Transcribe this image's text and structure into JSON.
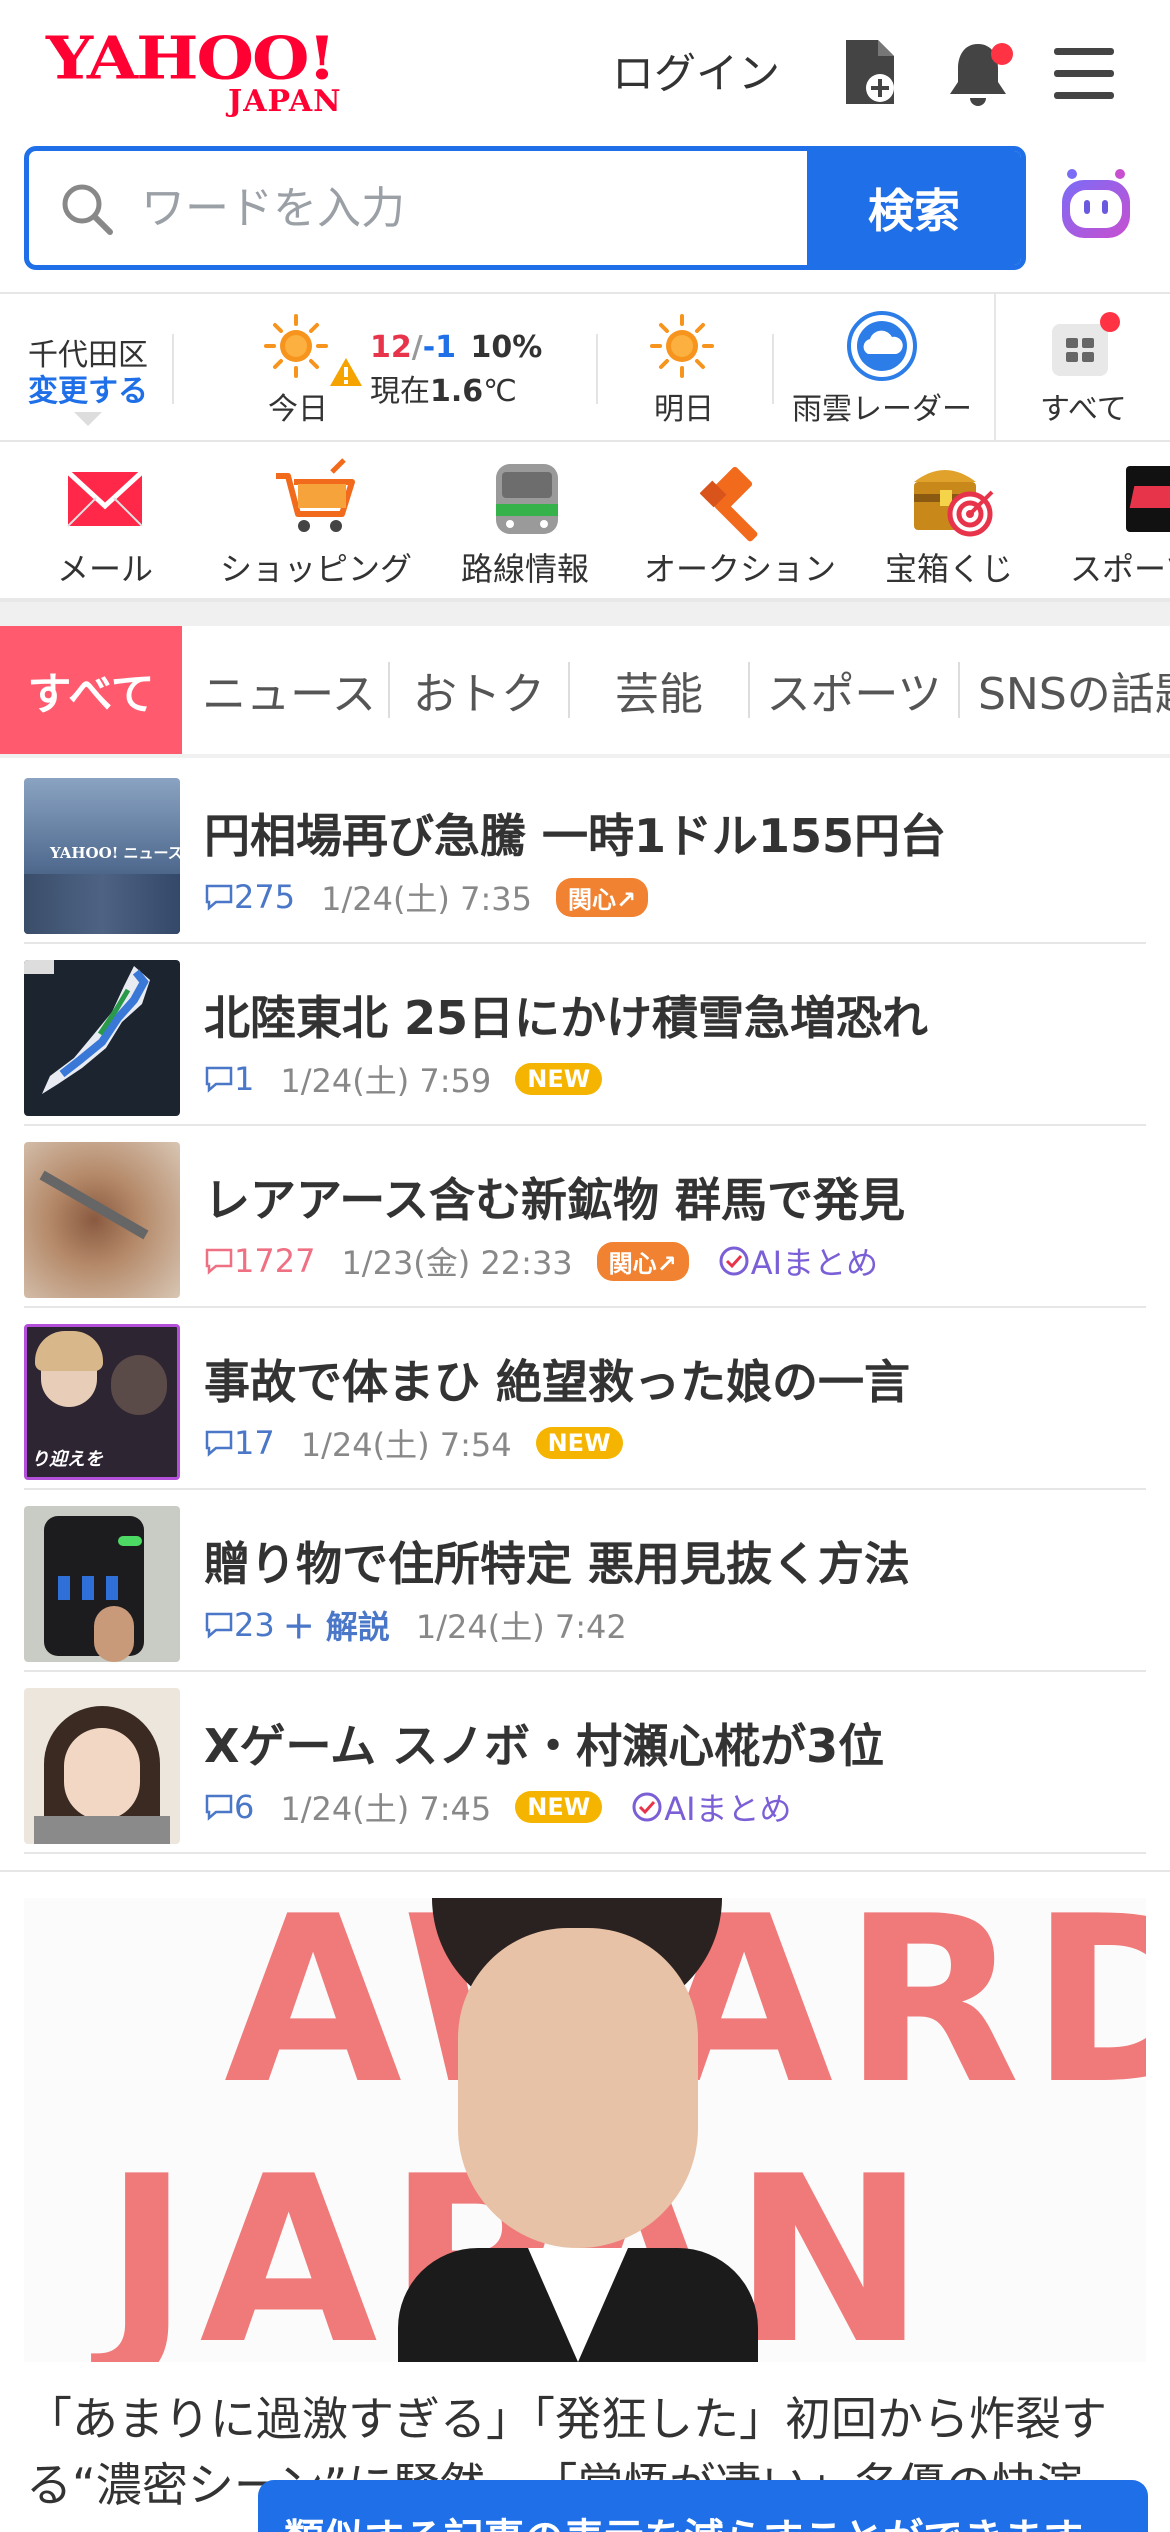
{
  "header": {
    "logo_main": "YAHOO!",
    "logo_sub": "JAPAN",
    "login": "ログイン"
  },
  "search": {
    "placeholder": "ワードを入力",
    "button": "検索"
  },
  "weather": {
    "location": "千代田区",
    "change": "変更する",
    "today_label": "今日",
    "high": "12",
    "slash": "/",
    "low": "-1",
    "precip": "10%",
    "now_prefix": "現在",
    "now_temp": "1.6",
    "now_unit": "℃",
    "tomorrow_label": "明日",
    "radar_label": "雨雲レーダー",
    "all_label": "すべて"
  },
  "services": [
    {
      "label": "メール"
    },
    {
      "label": "ショッピング"
    },
    {
      "label": "路線情報"
    },
    {
      "label": "オークション"
    },
    {
      "label": "宝箱くじ"
    },
    {
      "label": "スポーツ"
    }
  ],
  "tabs": [
    {
      "label": "すべて"
    },
    {
      "label": "ニュース"
    },
    {
      "label": "おトク"
    },
    {
      "label": "芸能"
    },
    {
      "label": "スポーツ"
    },
    {
      "label": "SNSの話題"
    }
  ],
  "news": [
    {
      "title": "円相場再び急騰 一時1ドル155円台",
      "comments": "275",
      "date": "1/24(土) 7:35",
      "badge": "関心",
      "ai": ""
    },
    {
      "title": "北陸東北 25日にかけ積雪急増恐れ",
      "comments": "1",
      "date": "1/24(土) 7:59",
      "badge": "NEW",
      "ai": ""
    },
    {
      "title": "レアアース含む新鉱物 群馬で発見",
      "comments": "1727",
      "date": "1/23(金) 22:33",
      "badge": "関心",
      "ai": "AIまとめ"
    },
    {
      "title": "事故で体まひ 絶望救った娘の一言",
      "comments": "17",
      "date": "1/24(土) 7:54",
      "badge": "NEW",
      "ai": ""
    },
    {
      "title": "贈り物で住所特定 悪用見抜く方法",
      "comments": "23",
      "extra": "＋ 解説",
      "date": "1/24(土) 7:42",
      "badge": "",
      "ai": ""
    },
    {
      "title": "Xゲーム スノボ・村瀬心椛が3位",
      "comments": "6",
      "date": "1/24(土) 7:45",
      "badge": "NEW",
      "ai": "AIまとめ"
    }
  ],
  "thumb_texts": {
    "yahoo_news": "YAHOO! ニュース",
    "welcome": "り迎えを"
  },
  "feature": {
    "bg_text_1": "AWARD",
    "bg_text_2": "JAPAN",
    "title": "「あまりに過激すぎる」「発狂した」初回から炸裂する“濃密シーン”に騒然…「覚悟が凄い」名優の快演"
  },
  "toast": "類似する記事の表示を減らすことができます",
  "colors": {
    "brand_red": "#ff0033",
    "accent_blue": "#1e6fe8",
    "tab_active": "#ff5a6e",
    "badge_new": "#f5b400",
    "badge_interest": "#f08232"
  }
}
